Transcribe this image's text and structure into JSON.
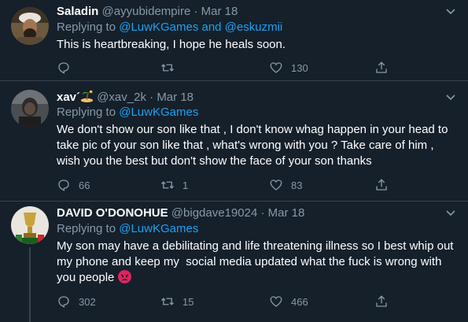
{
  "colors": {
    "background": "#15202b",
    "border": "#38444d",
    "secondary_text": "#8899a6",
    "link": "#1da1f2"
  },
  "tweets": [
    {
      "name": "Saladin",
      "handle": "@ayyubidempire",
      "dot": "·",
      "date": "Mar 18",
      "replying_prefix": "Replying to ",
      "replying_mentions": "@LuwKGames and @eskuzmii",
      "text": "This is heartbreaking, I hope he heals soon.",
      "reply_count": "",
      "retweet_count": "",
      "like_count": "130"
    },
    {
      "name": "xav",
      "name_suffix": "´",
      "handle": "@xav_2k",
      "dot": "·",
      "date": "Mar 18",
      "replying_prefix": "Replying to ",
      "replying_mentions": "@LuwKGames",
      "text": "We don't show our son like that , I don't know whag happen in your head to take pic of your son like that , what's wrong with you ? Take care of him , wish you the best but don't show the face of your son thanks",
      "reply_count": "66",
      "retweet_count": "1",
      "like_count": "83"
    },
    {
      "name": "DAVID O'DONOHUE",
      "handle": "@bigdave19024",
      "dot": "·",
      "date": "Mar 18",
      "replying_prefix": "Replying to ",
      "replying_mentions": "@LuwKGames",
      "text": "My son may have a debilitating and life threatening illness so I best whip out my phone and keep my  social media updated what the fuck is wrong with you people ",
      "reply_count": "302",
      "retweet_count": "15",
      "like_count": "466"
    }
  ]
}
